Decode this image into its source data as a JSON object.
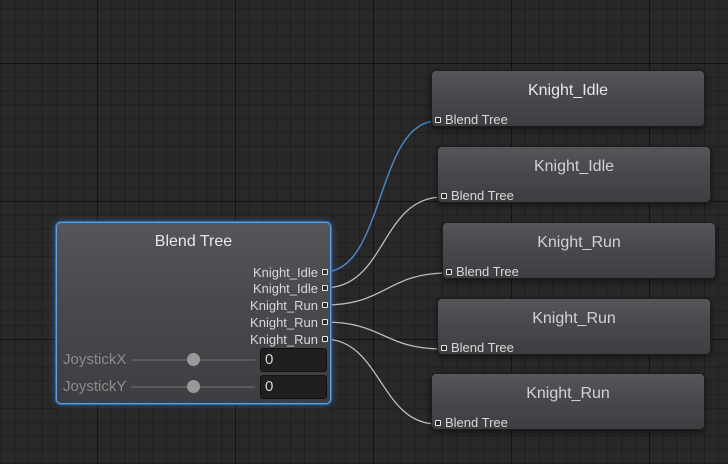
{
  "blend_tree": {
    "title": "Blend Tree",
    "outputs": [
      {
        "label": "Knight_Idle"
      },
      {
        "label": "Knight_Idle"
      },
      {
        "label": "Knight_Run"
      },
      {
        "label": "Knight_Run"
      },
      {
        "label": "Knight_Run"
      }
    ],
    "parameters": [
      {
        "name": "JoystickX",
        "value": "0",
        "slider_level": 0.5
      },
      {
        "name": "JoystickY",
        "value": "0",
        "slider_level": 0.5
      }
    ]
  },
  "motion_nodes": [
    {
      "title": "Knight_Idle",
      "input_label": "Blend Tree",
      "active": true
    },
    {
      "title": "Knight_Idle",
      "input_label": "Blend Tree",
      "active": false
    },
    {
      "title": "Knight_Run",
      "input_label": "Blend Tree",
      "active": false
    },
    {
      "title": "Knight_Run",
      "input_label": "Blend Tree",
      "active": false
    },
    {
      "title": "Knight_Run",
      "input_label": "Blend Tree",
      "active": false
    }
  ],
  "colors": {
    "background": "#282828",
    "selection_outline": "#58a2e8",
    "active_connection": "#4d83c6",
    "connection": "#bdbdbd"
  }
}
